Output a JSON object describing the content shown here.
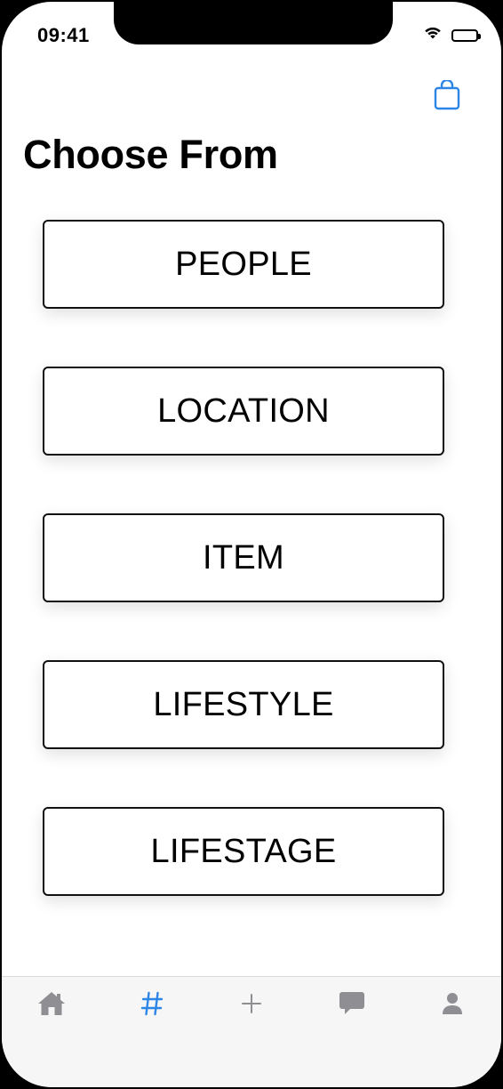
{
  "status_bar": {
    "time": "09:41"
  },
  "header": {
    "title": "Choose From",
    "bag_icon": "shopping-bag-icon",
    "accent_color": "#2D86E6"
  },
  "options": [
    {
      "label": "PEOPLE"
    },
    {
      "label": "LOCATION"
    },
    {
      "label": "ITEM"
    },
    {
      "label": "LIFESTYLE"
    },
    {
      "label": "LIFESTAGE"
    }
  ],
  "tab_bar": {
    "items": [
      {
        "icon": "home-icon",
        "active": false
      },
      {
        "icon": "hashtag-icon",
        "active": true
      },
      {
        "icon": "plus-icon",
        "active": false
      },
      {
        "icon": "chat-icon",
        "active": false
      },
      {
        "icon": "person-icon",
        "active": false
      }
    ],
    "inactive_color": "#8E8E93",
    "active_color": "#2D86E6"
  }
}
